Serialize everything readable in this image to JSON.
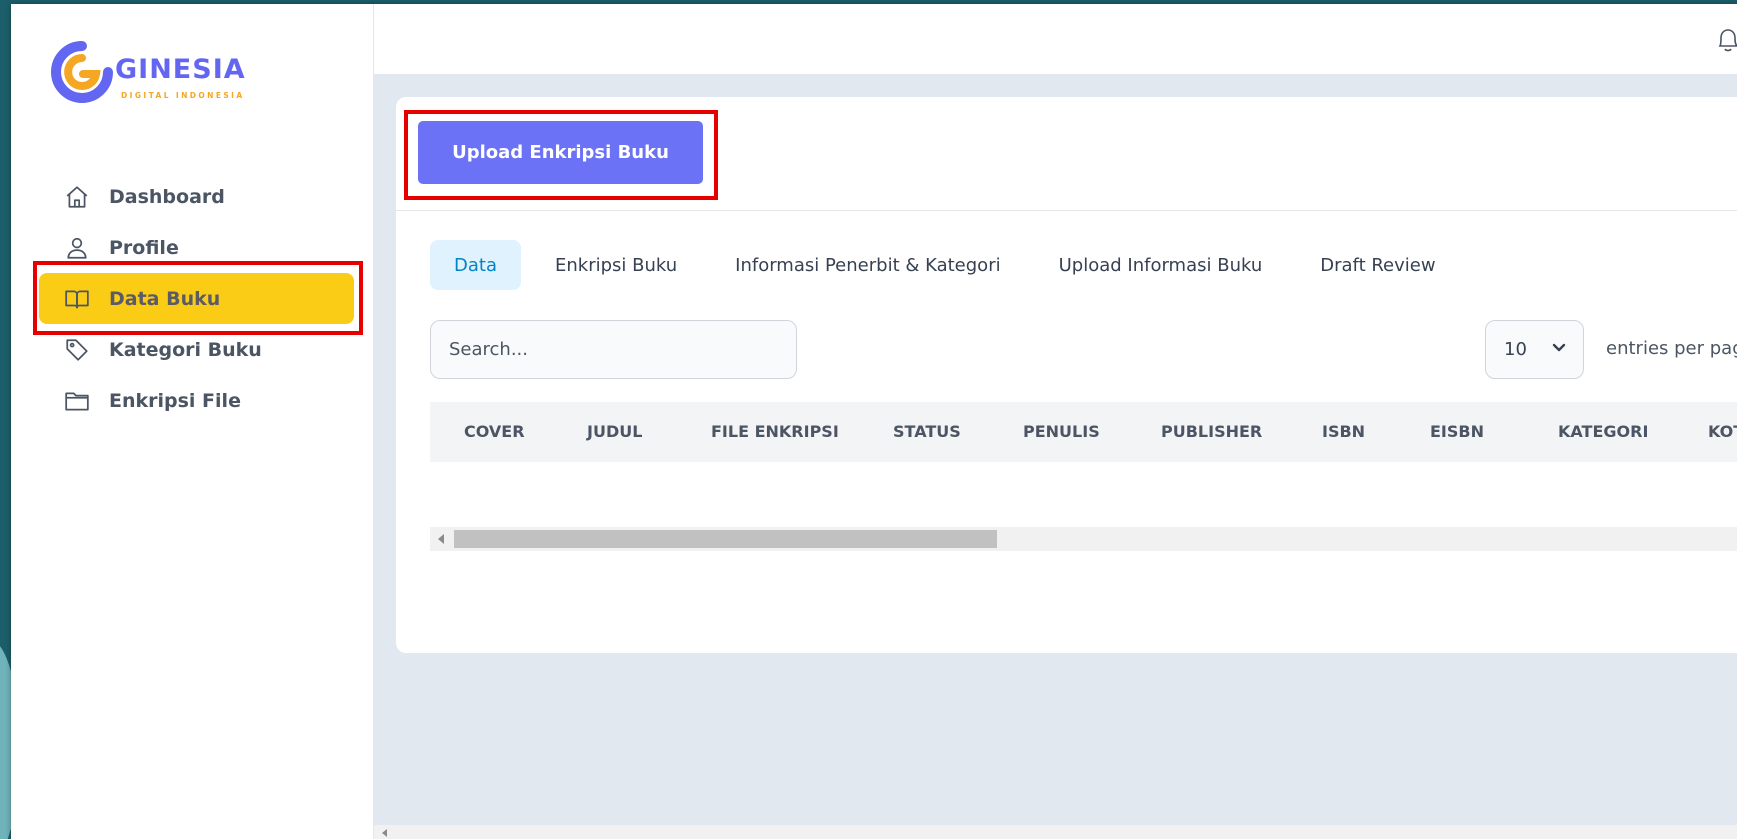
{
  "brand": {
    "name": "GINESIA",
    "tagline": "DIGITAL INDONESIA"
  },
  "sidebar": {
    "items": [
      {
        "label": "Dashboard",
        "icon": "home-icon"
      },
      {
        "label": "Profile",
        "icon": "user-icon"
      },
      {
        "label": "Data Buku",
        "icon": "book-open-icon",
        "active": true
      },
      {
        "label": "Kategori Buku",
        "icon": "tag-icon"
      },
      {
        "label": "Enkripsi File",
        "icon": "folder-icon"
      }
    ]
  },
  "toolbar": {
    "upload_label": "Upload Enkripsi Buku"
  },
  "tabs": [
    {
      "label": "Data",
      "active": true
    },
    {
      "label": "Enkripsi Buku"
    },
    {
      "label": "Informasi Penerbit & Kategori"
    },
    {
      "label": "Upload Informasi Buku"
    },
    {
      "label": "Draft Review"
    }
  ],
  "search": {
    "placeholder": "Search..."
  },
  "pagination": {
    "per_page_value": "10",
    "per_page_label": "entries per page"
  },
  "table": {
    "columns": [
      "COVER",
      "JUDUL",
      "FILE ENKRIPSI",
      "STATUS",
      "PENULIS",
      "PUBLISHER",
      "ISBN",
      "EISBN",
      "KATEGORI",
      "KOTA"
    ],
    "rows": []
  },
  "colors": {
    "accent": "#6b72f5",
    "active_nav": "#facc15",
    "highlight": "#e60000",
    "tab_active_bg": "#e0f2fe",
    "tab_active_text": "#0284c7"
  }
}
